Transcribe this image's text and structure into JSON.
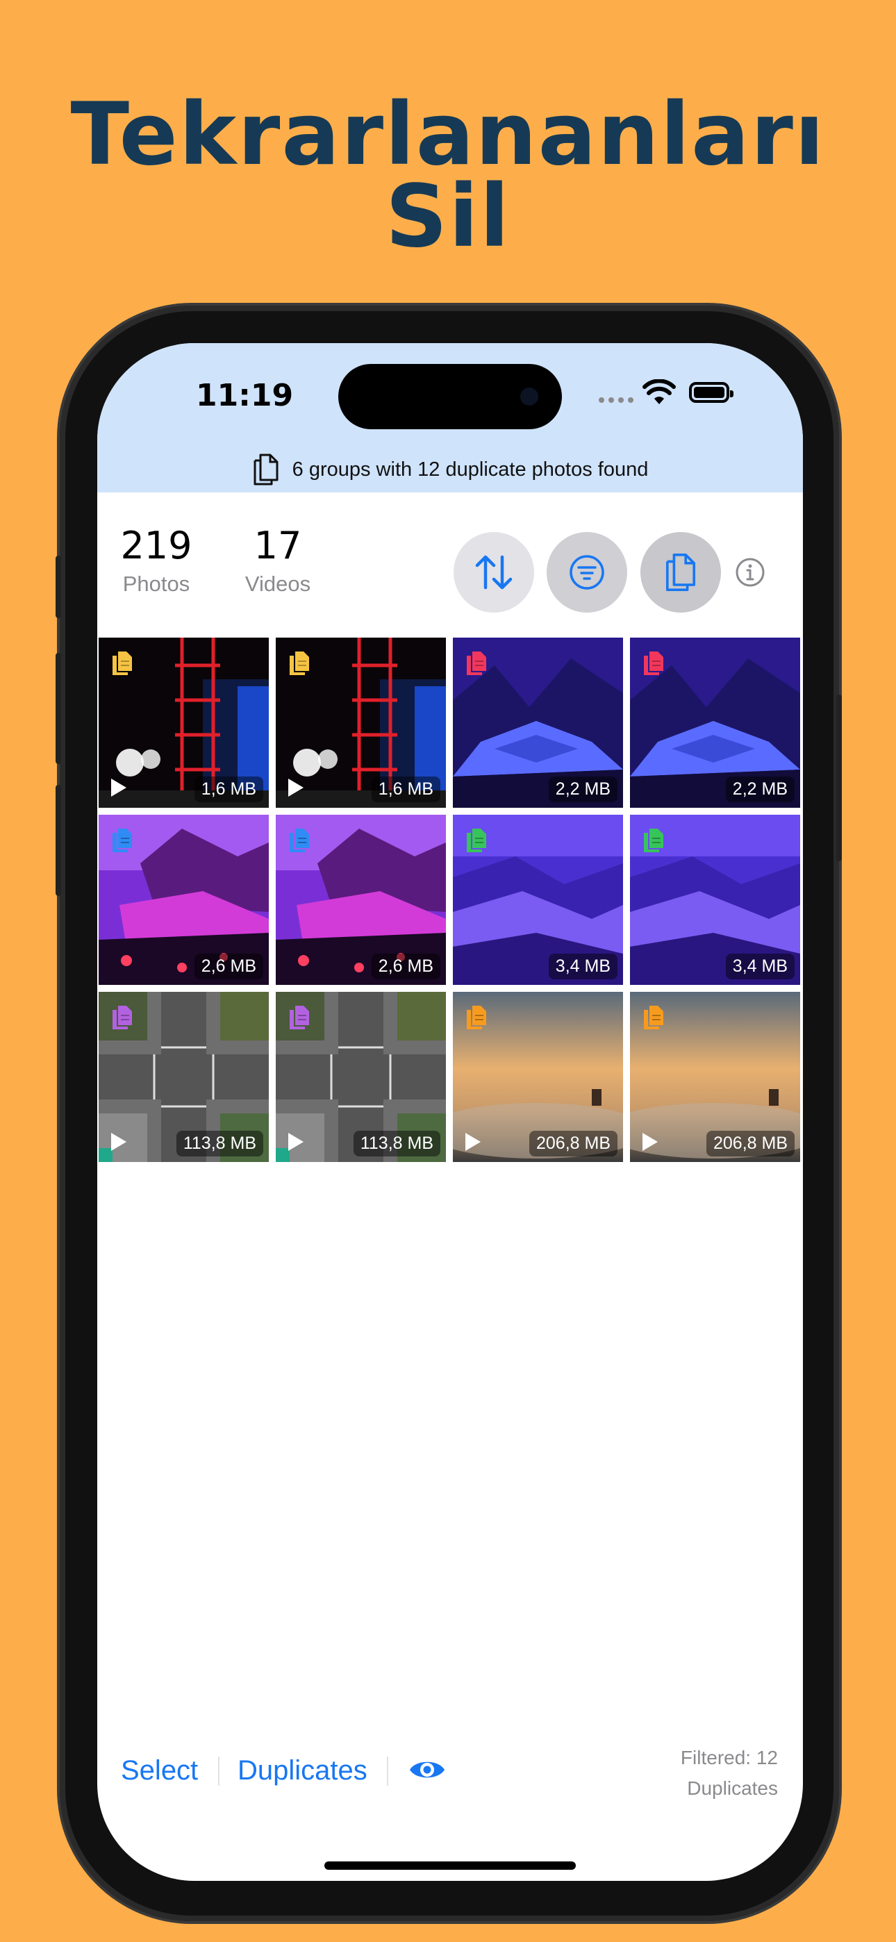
{
  "headline": {
    "line1": "Tekrarlananları",
    "line2": "Sil"
  },
  "status_bar": {
    "time": "11:19"
  },
  "banner": {
    "text": "6 groups with 12 duplicate photos found"
  },
  "stats": {
    "photos_count": "219",
    "photos_label": "Photos",
    "videos_count": "17",
    "videos_label": "Videos"
  },
  "toolbar": {
    "sort_icon": "arrow-up-down-icon",
    "filter_icon": "filter-lines-icon",
    "duplicates_icon": "copy-docs-icon",
    "info_icon": "info-circle-icon"
  },
  "grid": {
    "tiles": [
      {
        "size": "1,6 MB",
        "badge_color": "#F6C443",
        "video": true,
        "scene": "ferris"
      },
      {
        "size": "1,6 MB",
        "badge_color": "#F6C443",
        "video": true,
        "scene": "ferris"
      },
      {
        "size": "2,2 MB",
        "badge_color": "#F2375C",
        "video": false,
        "scene": "blue-mountain"
      },
      {
        "size": "2,2 MB",
        "badge_color": "#F2375C",
        "video": false,
        "scene": "blue-mountain"
      },
      {
        "size": "2,6 MB",
        "badge_color": "#2F8CF5",
        "video": false,
        "scene": "purple-lake"
      },
      {
        "size": "2,6 MB",
        "badge_color": "#2F8CF5",
        "video": false,
        "scene": "purple-lake"
      },
      {
        "size": "3,4 MB",
        "badge_color": "#37C45B",
        "video": false,
        "scene": "violet-dunes"
      },
      {
        "size": "3,4 MB",
        "badge_color": "#37C45B",
        "video": false,
        "scene": "violet-dunes"
      },
      {
        "size": "113,8 MB",
        "badge_color": "#B262E0",
        "video": true,
        "scene": "intersection"
      },
      {
        "size": "113,8 MB",
        "badge_color": "#B262E0",
        "video": true,
        "scene": "intersection"
      },
      {
        "size": "206,8 MB",
        "badge_color": "#F79B1E",
        "video": true,
        "scene": "foggy-city"
      },
      {
        "size": "206,8 MB",
        "badge_color": "#F79B1E",
        "video": true,
        "scene": "foggy-city"
      }
    ]
  },
  "bottom_bar": {
    "select_label": "Select",
    "duplicates_label": "Duplicates",
    "eye_icon": "eye-icon",
    "filtered_line1": "Filtered: 12",
    "filtered_line2": "Duplicates"
  },
  "colors": {
    "background": "#FDAE4B",
    "headline": "#163A55",
    "accent": "#1877F2",
    "status_bg": "#CFE3FB"
  }
}
